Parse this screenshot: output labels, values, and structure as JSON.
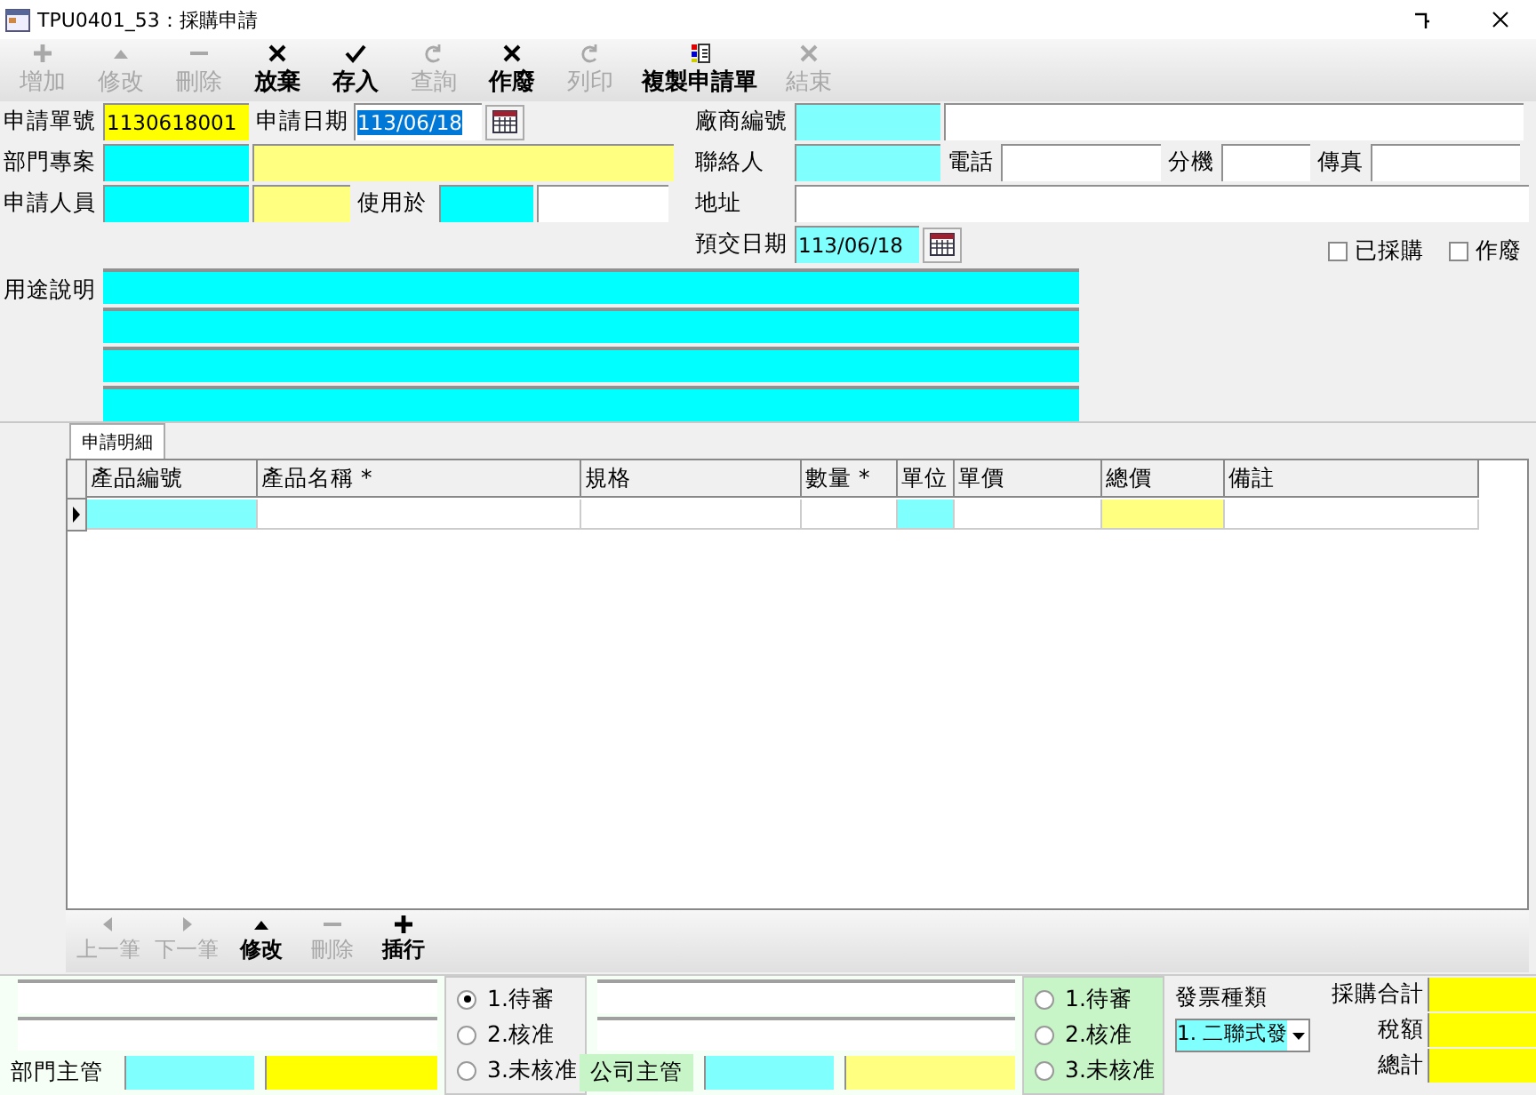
{
  "window": {
    "title": "TPU0401_53：採購申請"
  },
  "toolbar": [
    {
      "label": "增加",
      "disabled": true
    },
    {
      "label": "修改",
      "disabled": true
    },
    {
      "label": "刪除",
      "disabled": true
    },
    {
      "label": "放棄",
      "disabled": false
    },
    {
      "label": "存入",
      "disabled": false
    },
    {
      "label": "查詢",
      "disabled": true
    },
    {
      "label": "作廢",
      "disabled": false
    },
    {
      "label": "列印",
      "disabled": true
    },
    {
      "label": "複製申請單",
      "disabled": false
    },
    {
      "label": "結束",
      "disabled": true
    }
  ],
  "form_left": [
    {
      "items": [
        {
          "kind": "label",
          "text": "申請單號"
        },
        {
          "kind": "field",
          "color": "#ffff00",
          "value": "1130618001"
        },
        {
          "kind": "label",
          "text": "申請日期"
        },
        {
          "kind": "field",
          "color": "#ffffff",
          "value": "113/06/18",
          "selected": true
        },
        {
          "kind": "calendar"
        }
      ]
    },
    {
      "items": [
        {
          "kind": "label",
          "text": "部門專案"
        },
        {
          "kind": "field",
          "color": "#00ffff"
        },
        {
          "kind": "field",
          "color": "#ffff80"
        }
      ]
    },
    {
      "items": [
        {
          "kind": "label",
          "text": "申請人員"
        },
        {
          "kind": "field",
          "color": "#00ffff"
        },
        {
          "kind": "field",
          "color": "#ffff80"
        },
        {
          "kind": "label",
          "text": "使用於"
        },
        {
          "kind": "field",
          "color": "#00ffff"
        },
        {
          "kind": "field",
          "color": "#ffffff"
        }
      ]
    }
  ],
  "form_right": [
    {
      "items": [
        {
          "kind": "label",
          "text": "廠商編號"
        },
        {
          "kind": "field",
          "color": "#80ffff"
        },
        {
          "kind": "field",
          "color": "#ffffff"
        }
      ]
    },
    {
      "items": [
        {
          "kind": "label",
          "text": "聯絡人"
        },
        {
          "kind": "field",
          "color": "#80ffff"
        },
        {
          "kind": "label",
          "text": "電話"
        },
        {
          "kind": "field",
          "color": "#ffffff"
        },
        {
          "kind": "label",
          "text": "分機"
        },
        {
          "kind": "field",
          "color": "#ffffff"
        },
        {
          "kind": "label",
          "text": "傳真"
        },
        {
          "kind": "field",
          "color": "#ffffff"
        }
      ]
    },
    {
      "items": [
        {
          "kind": "label",
          "text": "地址"
        },
        {
          "kind": "field",
          "color": "#ffffff"
        }
      ]
    },
    {
      "items": [
        {
          "kind": "label",
          "text": "預交日期"
        },
        {
          "kind": "field",
          "color": "#80ffff",
          "value": "113/06/18"
        },
        {
          "kind": "calendar"
        }
      ]
    }
  ],
  "flags": [
    {
      "label": "已採購",
      "checked": false
    },
    {
      "label": "作廢",
      "checked": false
    }
  ],
  "purpose": {
    "label": "用途說明",
    "lines": [
      {
        "color": "#00ffff"
      },
      {
        "color": "#00ffff"
      },
      {
        "color": "#00ffff"
      },
      {
        "color": "#00ffff"
      }
    ]
  },
  "tabs": [
    {
      "label": "申請明細",
      "selected": true
    }
  ],
  "table": {
    "columns": [
      {
        "label": "產品編號"
      },
      {
        "label": "產品名稱 *"
      },
      {
        "label": "規格"
      },
      {
        "label": "數量 *"
      },
      {
        "label": "單位"
      },
      {
        "label": "單價"
      },
      {
        "label": "總價"
      },
      {
        "label": "備註"
      }
    ],
    "rows": [
      {
        "current": true,
        "cells": [
          {
            "color": "#80ffff"
          },
          {
            "color": "#ffffff"
          },
          {
            "color": "#ffffff"
          },
          {
            "color": "#ffffff"
          },
          {
            "color": "#80ffff"
          },
          {
            "color": "#ffffff"
          },
          {
            "color": "#ffff80"
          },
          {
            "color": "#ffffff"
          }
        ]
      }
    ]
  },
  "grid_toolbar": [
    {
      "label": "上一筆",
      "disabled": true
    },
    {
      "label": "下一筆",
      "disabled": true
    },
    {
      "label": "修改",
      "disabled": false
    },
    {
      "label": "刪除",
      "disabled": true
    },
    {
      "label": "插行",
      "disabled": false
    }
  ],
  "approvals": [
    {
      "label": "部門主管",
      "options": [
        {
          "label": "1.待審",
          "selected": true
        },
        {
          "label": "2.核准",
          "selected": false
        },
        {
          "label": "3.未核准",
          "selected": false
        }
      ]
    },
    {
      "label": "公司主管",
      "options": [
        {
          "label": "1.待審",
          "selected": false
        },
        {
          "label": "2.核准",
          "selected": false
        },
        {
          "label": "3.未核准",
          "selected": false
        }
      ]
    }
  ],
  "invoice": {
    "label": "發票種類",
    "value": "1. 二聯式發"
  },
  "totals": [
    {
      "label": "採購合計"
    },
    {
      "label": "稅額"
    },
    {
      "label": "總計"
    }
  ]
}
